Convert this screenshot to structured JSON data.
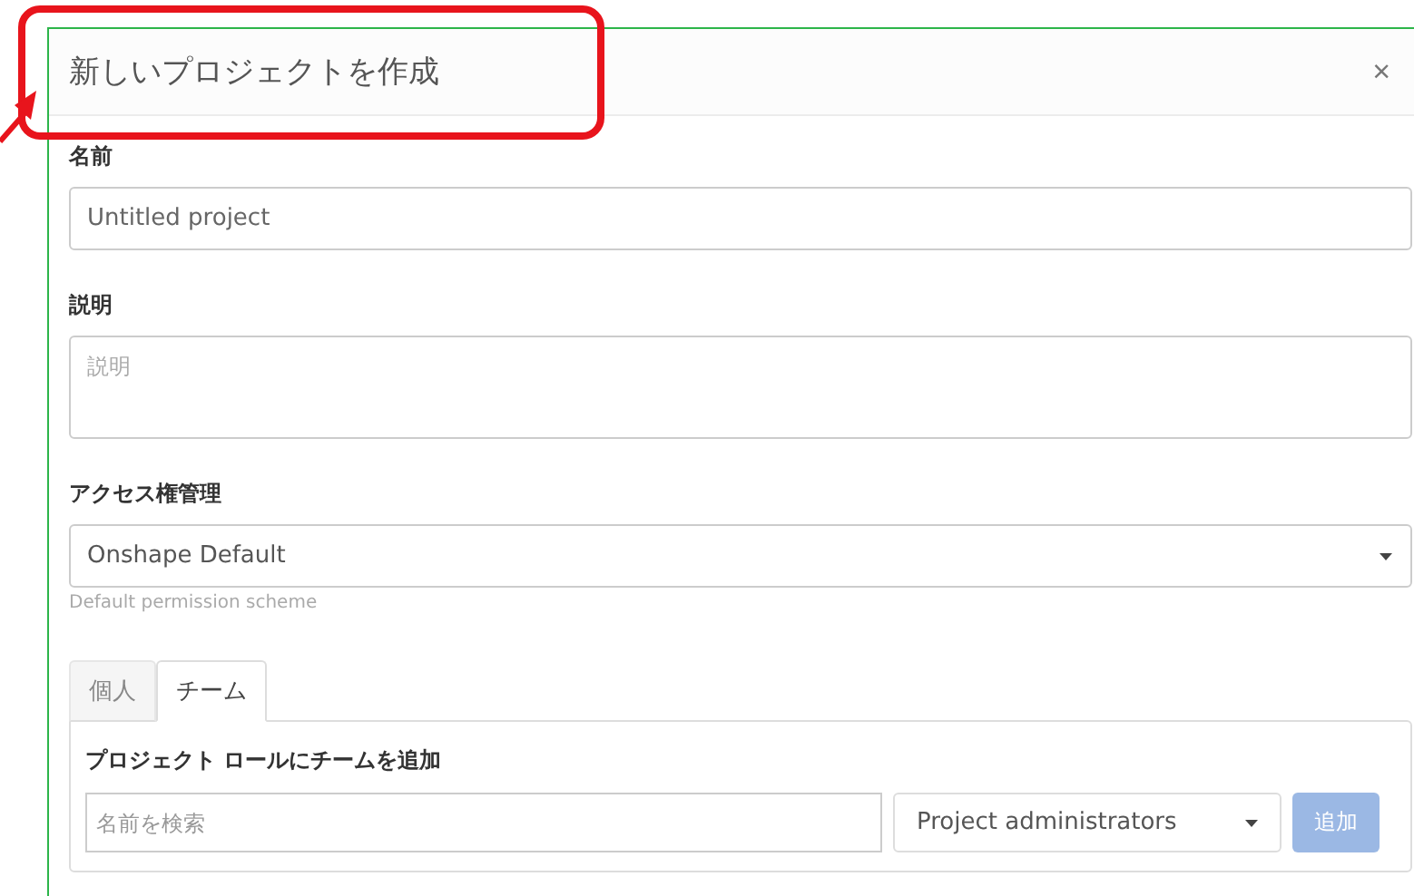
{
  "dialog": {
    "title": "新しいプロジェクトを作成",
    "close": "×"
  },
  "fields": [
    {
      "kind": "input",
      "label": "名前",
      "value": "Untitled project"
    },
    {
      "kind": "textarea",
      "label": "説明",
      "placeholder": "説明"
    },
    {
      "kind": "select",
      "label": "アクセス権管理",
      "value": "Onshape Default",
      "hint": "Default permission scheme"
    }
  ],
  "tabs": [
    {
      "label": "個人",
      "selected": false
    },
    {
      "label": "チーム",
      "selected": true
    }
  ],
  "team_panel": {
    "heading": "プロジェクト ロールにチームを追加",
    "search": {
      "placeholder": "名前を検索"
    },
    "role": "Project administrators",
    "add_button": {
      "label": "追加",
      "disabled": true
    }
  }
}
